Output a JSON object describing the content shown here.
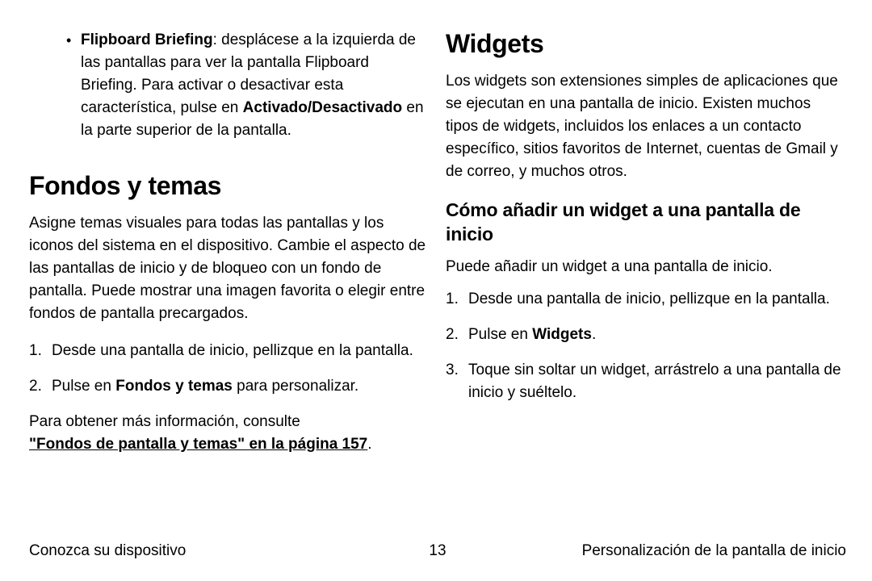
{
  "left": {
    "bullet": {
      "lead_bold": "Flipboard Briefing",
      "text_after_lead": ": desplácese a la izquierda de las pantallas para ver la pantalla Flipboard Briefing. Para activar o desactivar esta característica, pulse en ",
      "inner_bold": "Activado/Desactivado",
      "tail": " en la parte superior de la pantalla."
    },
    "heading": "Fondos y temas",
    "intro": "Asigne temas visuales para todas las pantallas y los iconos del sistema en el dispositivo. Cambie el aspecto de las pantallas de inicio y de bloqueo con un fondo de pantalla. Puede mostrar una imagen favorita o elegir entre fondos de pantalla precargados.",
    "steps": [
      {
        "num": "1.",
        "text": "Desde una pantalla de inicio, pellizque en la pantalla."
      },
      {
        "num": "2.",
        "prefix": "Pulse en ",
        "bold": "Fondos y temas",
        "suffix": " para personalizar."
      }
    ],
    "moreinfo_lead": "Para obtener más información, consulte ",
    "moreinfo_link": "\"Fondos de pantalla y temas\" en la página 157",
    "moreinfo_tail": "."
  },
  "right": {
    "heading": "Widgets",
    "intro": "Los widgets son extensiones simples de aplicaciones que se ejecutan en una pantalla de inicio. Existen muchos tipos de widgets, incluidos los enlaces a un contacto específico, sitios favoritos de Internet, cuentas de Gmail y de correo, y muchos otros.",
    "subheading": "Cómo añadir un widget a una pantalla de inicio",
    "subintro": "Puede añadir un widget a una pantalla de inicio.",
    "steps": [
      {
        "num": "1.",
        "text": "Desde una pantalla de inicio, pellizque en la pantalla."
      },
      {
        "num": "2.",
        "prefix": "Pulse en ",
        "bold": "Widgets",
        "suffix": "."
      },
      {
        "num": "3.",
        "text": "Toque sin soltar un widget, arrástrelo a una pantalla de inicio y suéltelo."
      }
    ]
  },
  "footer": {
    "left": "Conozca su dispositivo",
    "center": "13",
    "right": "Personalización de la pantalla de inicio"
  }
}
